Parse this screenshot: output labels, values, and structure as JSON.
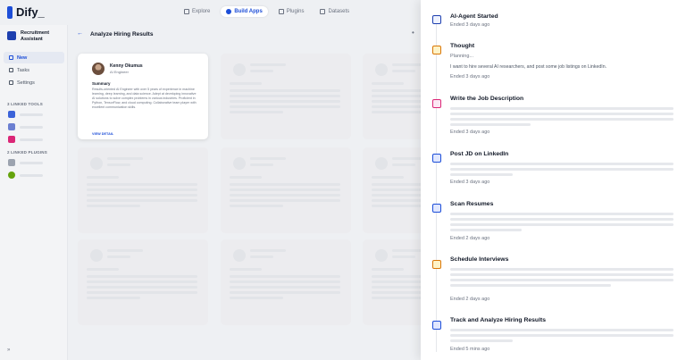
{
  "app": {
    "logo_text": "Dify_",
    "brand_color": "#1d4ed8"
  },
  "topnav": [
    {
      "label": "Explore",
      "icon": "compass-icon",
      "active": false
    },
    {
      "label": "Build Apps",
      "icon": "gear-icon",
      "active": true
    },
    {
      "label": "Plugins",
      "icon": "plug-icon",
      "active": false
    },
    {
      "label": "Datasets",
      "icon": "database-icon",
      "active": false
    }
  ],
  "sidebar": {
    "app_name": "Recruitment Assistant",
    "nav": [
      {
        "label": "New",
        "icon": "plus-icon",
        "active": true
      },
      {
        "label": "Tasks",
        "icon": "tasks-icon",
        "active": false
      },
      {
        "label": "Settings",
        "icon": "settings-icon",
        "active": false
      }
    ],
    "linked_tools_label": "3 LINKED TOOLS",
    "linked_plugins_label": "2 LINKED PLUGINS",
    "toggle_label": "»"
  },
  "content": {
    "back_label": "←",
    "title": "Analyze Hiring Results",
    "more_label": "•"
  },
  "candidate": {
    "name": "Kenny Okumus",
    "role": "AI Engineer",
    "summary_heading": "Summary",
    "summary": "Results-oriented AI Engineer with over 5 years of experience in machine learning, deep learning, and data science. Adept at developing innovative AI solutions to solve complex problems in various industries. Proficient in Python, TensorFlow, and cloud computing. Collaborative team player with excellent communication skills.",
    "view_label": "VIEW DETAIL"
  },
  "timeline": [
    {
      "title": "AI-Agent Started",
      "meta": "Ended 3 days ago",
      "icon": "agent-icon",
      "color": "#1e40af",
      "bg": "#eef2ff"
    },
    {
      "title": "Thought",
      "sub": "Planning...",
      "message": "I want to hire several AI researchers, and post some job listings on LinkedIn.",
      "meta": "Ended 3 days ago",
      "icon": "thought-icon",
      "color": "#d97706",
      "bg": "#fef3c7"
    },
    {
      "title": "Write the Job Description",
      "meta": "Ended 3 days ago",
      "icon": "pen-icon",
      "color": "#db2777",
      "bg": "#fce7f3"
    },
    {
      "title": "Post JD on LinkedIn",
      "meta": "Ended 3 days ago",
      "icon": "linkedin-icon",
      "color": "#1d4ed8",
      "bg": "#e0e7ff"
    },
    {
      "title": "Scan Resumes",
      "meta": "Ended 2 days ago",
      "icon": "scan-icon",
      "color": "#1d4ed8",
      "bg": "#e0e7ff"
    },
    {
      "title": "Schedule Interviews",
      "meta": "Ended 2 days ago",
      "icon": "calendar-icon",
      "color": "#d97706",
      "bg": "#fef3c7"
    },
    {
      "title": "Track and Analyze Hiring Results",
      "meta": "Ended 5 mins ago",
      "icon": "chart-icon",
      "color": "#1d4ed8",
      "bg": "#e0e7ff"
    }
  ]
}
